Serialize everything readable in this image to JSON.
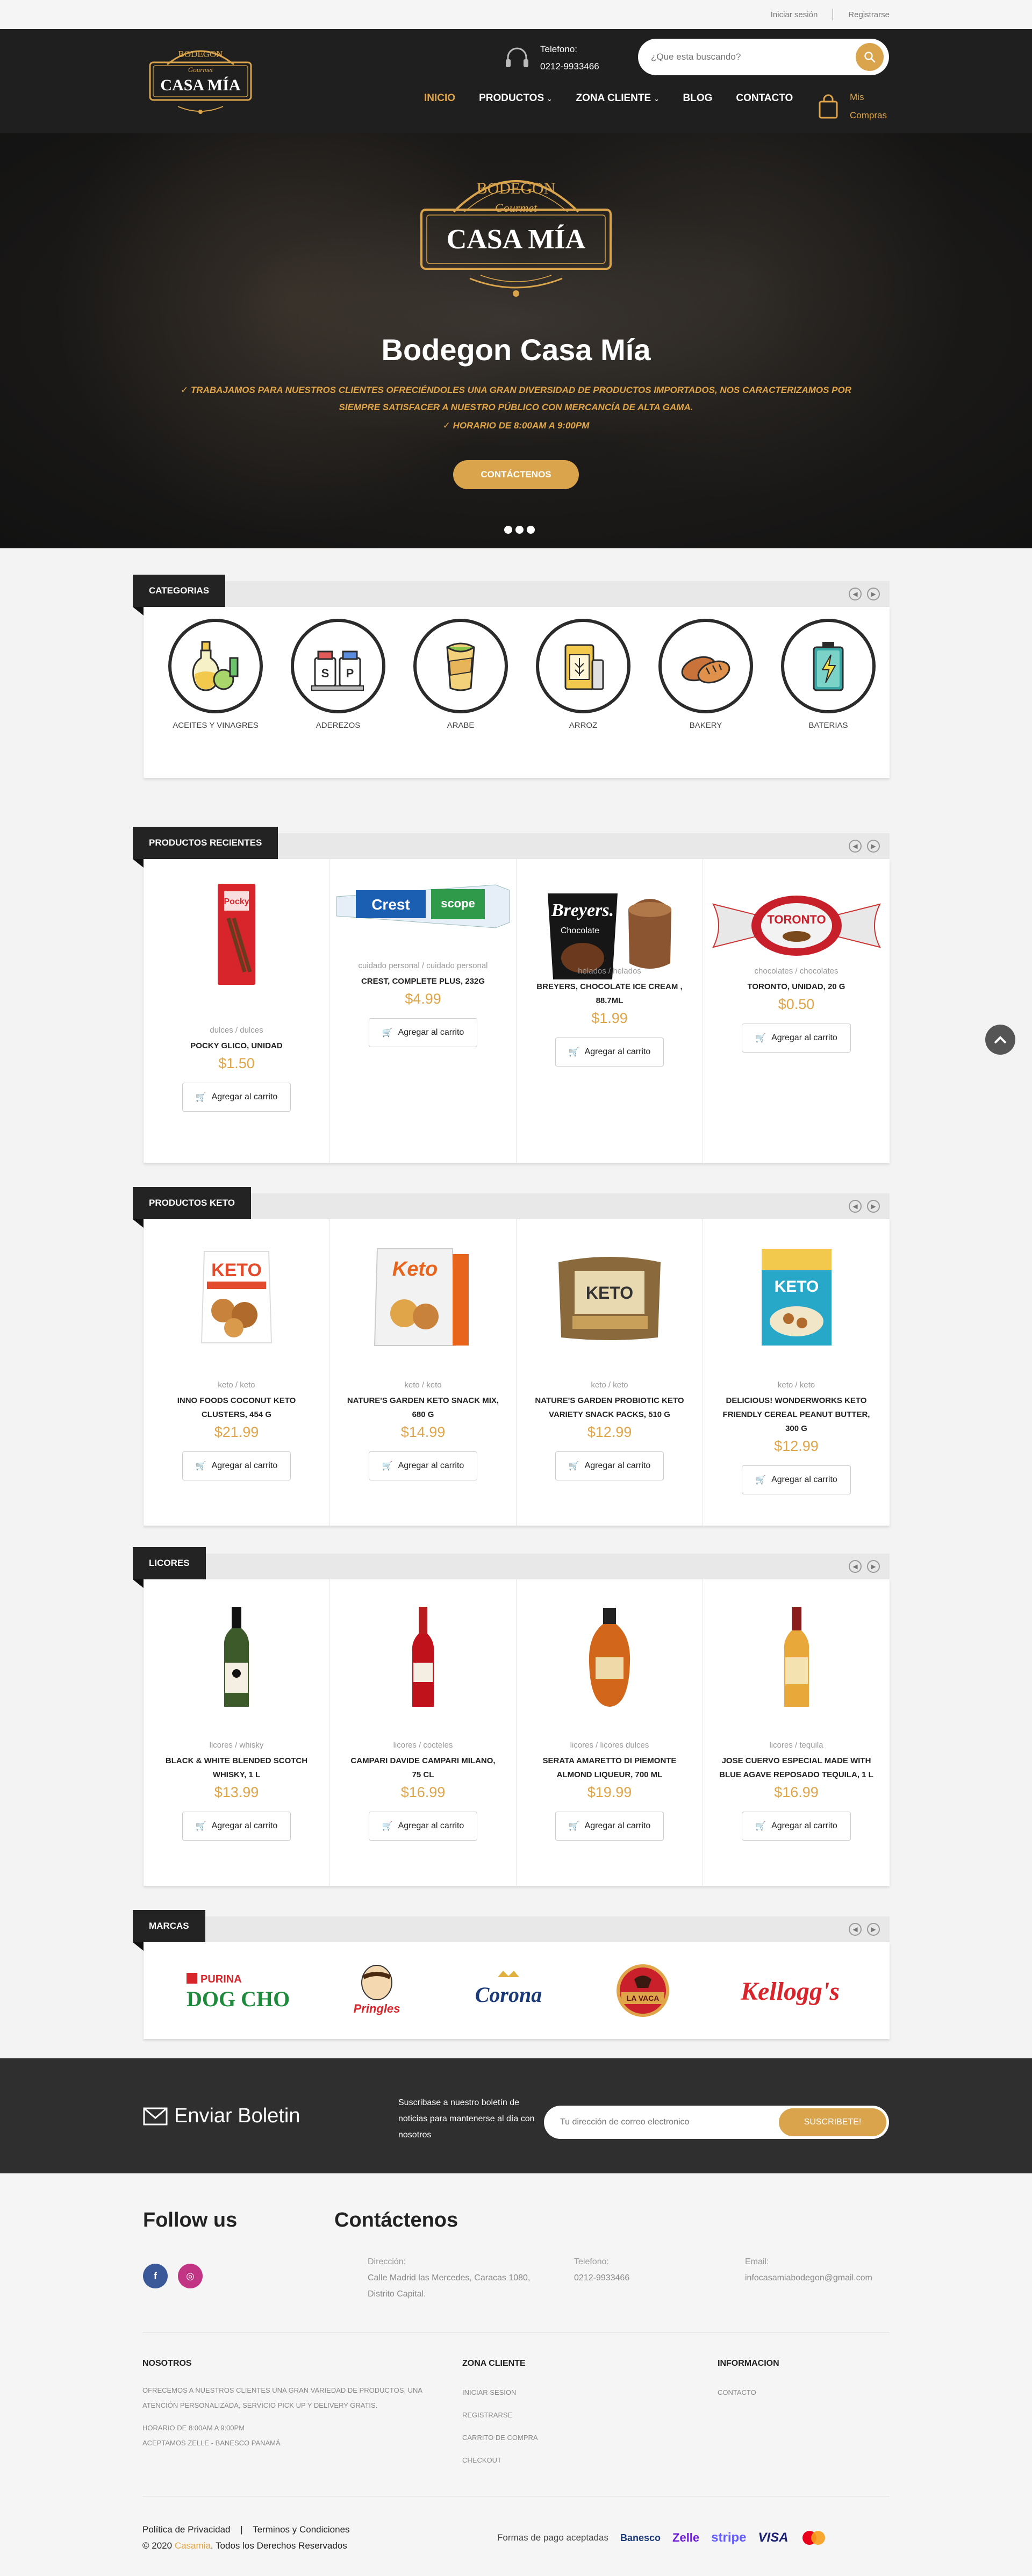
{
  "topbar": {
    "login": "Iniciar sesión",
    "register": "Registrarse"
  },
  "header": {
    "logo_text": {
      "top": "BODEGON",
      "middle": "Gourmet",
      "main": "CASA MÍA"
    },
    "phone_label": "Telefono:",
    "phone_number": "0212-9933466",
    "search_placeholder": "¿Que esta buscando?",
    "nav": [
      {
        "label": "INICIO",
        "active": true
      },
      {
        "label": "PRODUCTOS",
        "dropdown": true
      },
      {
        "label": "ZONA CLIENTE",
        "dropdown": true
      },
      {
        "label": "BLOG"
      },
      {
        "label": "CONTACTO"
      }
    ],
    "cart_line1": "Mis",
    "cart_line2": "Compras"
  },
  "hero": {
    "title": "Bodegon Casa Mía",
    "line1": "TRABAJAMOS PARA NUESTROS CLIENTES OFRECIÉNDOLES UNA GRAN DIVERSIDAD DE PRODUCTOS IMPORTADOS, NOS CARACTERIZAMOS POR",
    "line2": "SIEMPRE SATISFACER A NUESTRO PÚBLICO CON MERCANCÍA DE ALTA GAMA.",
    "line3": "HORARIO DE 8:00AM A 9:00PM",
    "cta": "CONTÁCTENOS",
    "slides": 3
  },
  "categories": {
    "title": "CATEGORIAS",
    "items": [
      {
        "label": "ACEITES Y VINAGRES",
        "icon": "oil-vinegar-icon"
      },
      {
        "label": "ADEREZOS",
        "icon": "salt-pepper-icon"
      },
      {
        "label": "ARABE",
        "icon": "wrap-icon"
      },
      {
        "label": "ARROZ",
        "icon": "rice-icon"
      },
      {
        "label": "BAKERY",
        "icon": "bread-icon"
      },
      {
        "label": "BATERIAS",
        "icon": "battery-icon"
      }
    ]
  },
  "recent": {
    "title": "PRODUCTOS RECIENTES",
    "add_label": "Agregar al carrito",
    "items": [
      {
        "cats": "dulces / dulces",
        "name": "POCKY GLICO, UNIDAD",
        "price": "$1.50"
      },
      {
        "cats": "cuidado personal / cuidado personal",
        "name": "CREST, COMPLETE PLUS, 232G",
        "price": "$4.99"
      },
      {
        "cats": "helados / helados",
        "name": "BREYERS, CHOCOLATE ICE CREAM , 88.7ML",
        "price": "$1.99"
      },
      {
        "cats": "chocolates / chocolates",
        "name": "TORONTO, UNIDAD, 20 G",
        "price": "$0.50"
      }
    ]
  },
  "keto": {
    "title": "PRODUCTOS KETO",
    "add_label": "Agregar al carrito",
    "items": [
      {
        "cats": "keto / keto",
        "name": "INNO FOODS COCONUT KETO CLUSTERS, 454 G",
        "price": "$21.99"
      },
      {
        "cats": "keto / keto",
        "name": "NATURE'S GARDEN KETO SNACK MIX, 680 G",
        "price": "$14.99"
      },
      {
        "cats": "keto / keto",
        "name": "NATURE'S GARDEN PROBIOTIC KETO VARIETY SNACK PACKS, 510 G",
        "price": "$12.99"
      },
      {
        "cats": "keto / keto",
        "name": "DELICIOUS! WONDERWORKS KETO FRIENDLY CEREAL PEANUT BUTTER, 300 G",
        "price": "$12.99"
      }
    ]
  },
  "licores": {
    "title": "LICORES",
    "add_label": "Agregar al carrito",
    "items": [
      {
        "cats": "licores / whisky",
        "name": "BLACK & WHITE BLENDED SCOTCH WHISKY, 1 L",
        "price": "$13.99"
      },
      {
        "cats": "licores / cocteles",
        "name": "CAMPARI DAVIDE CAMPARI MILANO, 75 CL",
        "price": "$16.99"
      },
      {
        "cats": "licores / licores dulces",
        "name": "SERATA AMARETTO DI PIEMONTE ALMOND LIQUEUR, 700 ML",
        "price": "$19.99"
      },
      {
        "cats": "licores / tequila",
        "name": "JOSE CUERVO ESPECIAL MADE WITH BLUE AGAVE REPOSADO TEQUILA, 1 L",
        "price": "$16.99"
      }
    ]
  },
  "brands": {
    "title": "MARCAS",
    "items": [
      {
        "name": "PURINA",
        "name2": "DOG CHOW"
      },
      {
        "name": "Pringles"
      },
      {
        "name": "Corona"
      },
      {
        "name": "LA VACA"
      },
      {
        "name": "Kellogg's"
      }
    ]
  },
  "newsletter": {
    "title": "Enviar Boletin",
    "desc": "Suscribase a nuestro boletín de noticias para mantenerse al día con nosotros",
    "placeholder": "Tu dirección de correo electronico",
    "button": "SUSCRIBETE!"
  },
  "footer": {
    "follow_title": "Follow us",
    "social": [
      {
        "icon": "facebook-icon",
        "glyph": "f"
      },
      {
        "icon": "instagram-icon",
        "glyph": "◎"
      }
    ],
    "contact_title": "Contáctenos",
    "address_label": "Dirección:",
    "address_value": "Calle Madrid las Mercedes, Caracas 1080, Distrito Capital.",
    "phone_label": "Telefono:",
    "phone_value": "0212-9933466",
    "email_label": "Email:",
    "email_value": "infocasamiabodegon@gmail.com",
    "nosotros_title": "NOSOTROS",
    "nosotros_text1": "OFRECEMOS A NUESTROS CLIENTES UNA GRAN VARIEDAD DE PRODUCTOS, UNA ATENCIÓN PERSONALIZADA, SERVICIO PICK UP Y DELIVERY GRATIS.",
    "nosotros_text2": "HORARIO DE 8:00AM A 9:00PM",
    "nosotros_text3": "ACEPTAMOS ZELLE - BANESCO PANAMÁ",
    "zona_title": "ZONA CLIENTE",
    "zona_links": [
      "INICIAR SESION",
      "REGISTRARSE",
      "CARRITO DE COMPRA",
      "CHECKOUT"
    ],
    "info_title": "INFORMACION",
    "info_links": [
      "CONTACTO"
    ],
    "privacy": "Política de Privacidad",
    "terms": "Terminos y Condiciones",
    "copyright_pre": "© 2020",
    "copyright_brand": "Casamia",
    "copyright_post": ". Todos los Derechos Reservados",
    "payments_label": "Formas de pago aceptadas",
    "payments": [
      "Banesco",
      "Zelle",
      "stripe",
      "VISA"
    ]
  },
  "colors": {
    "accent": "#d9a44b",
    "dark": "#1f1f1f",
    "newsletter_bg": "#2f2f2f"
  }
}
